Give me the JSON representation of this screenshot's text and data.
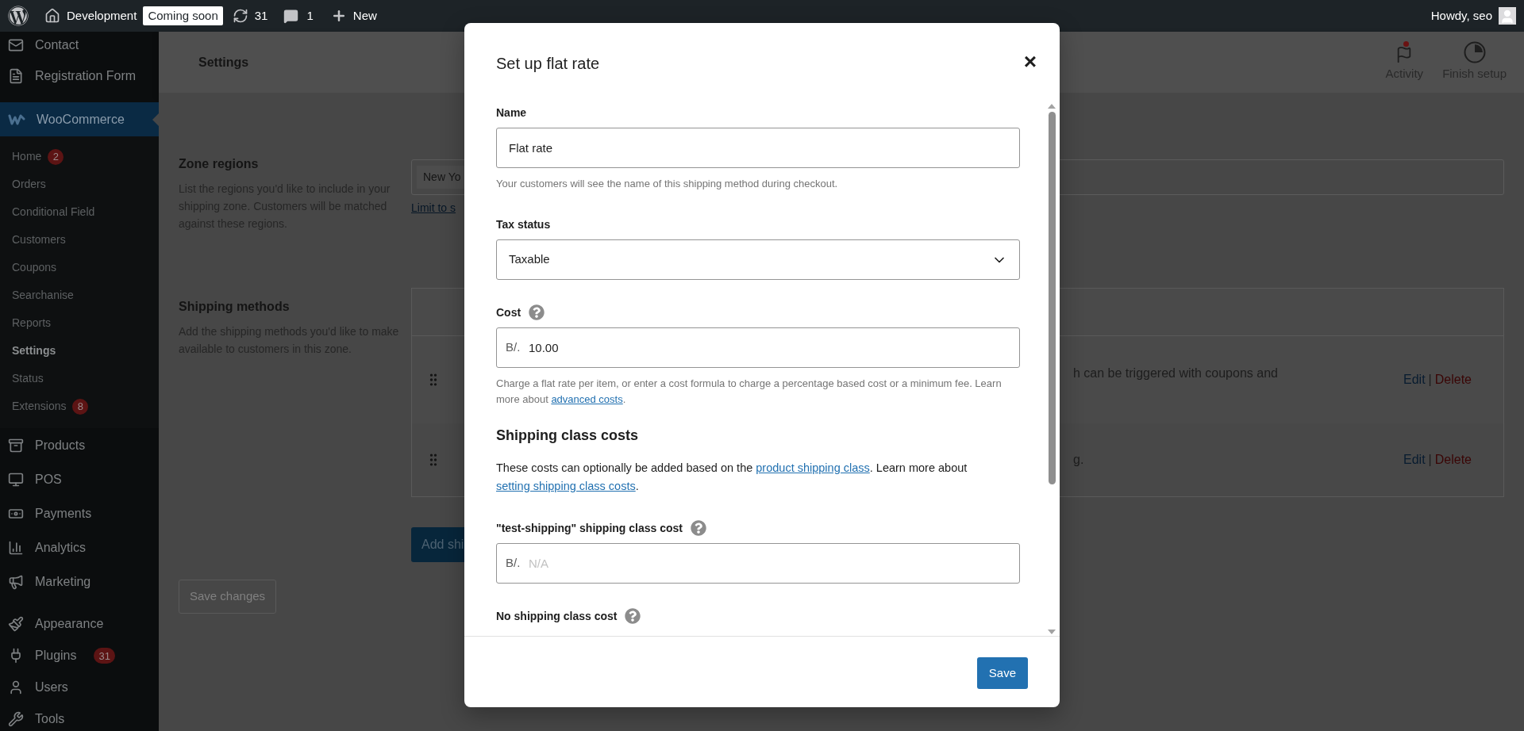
{
  "admin_bar": {
    "site_name": "Development",
    "status_badge": "Coming soon",
    "updates_count": "31",
    "comments_count": "1",
    "new_label": "New",
    "greeting": "Howdy, seo"
  },
  "sidebar": {
    "items": [
      {
        "label": "Contact",
        "selected": false
      },
      {
        "label": "Registration Form",
        "selected": false
      },
      {
        "label": "WooCommerce",
        "selected": true,
        "children": [
          {
            "label": "Home",
            "badge": "2",
            "selected": false
          },
          {
            "label": "Orders",
            "selected": false
          },
          {
            "label": "Conditional Field",
            "selected": false
          },
          {
            "label": "Customers",
            "selected": false
          },
          {
            "label": "Coupons",
            "selected": false
          },
          {
            "label": "Searchanise",
            "selected": false
          },
          {
            "label": "Reports",
            "selected": false
          },
          {
            "label": "Settings",
            "selected": true
          },
          {
            "label": "Status",
            "selected": false
          },
          {
            "label": "Extensions",
            "badge": "8",
            "selected": false
          }
        ]
      },
      {
        "label": "Products",
        "selected": false
      },
      {
        "label": "POS",
        "selected": false
      },
      {
        "label": "Payments",
        "selected": false
      },
      {
        "label": "Analytics",
        "selected": false
      },
      {
        "label": "Marketing",
        "selected": false
      },
      {
        "label": "Appearance",
        "selected": false
      },
      {
        "label": "Plugins",
        "badge": "31",
        "selected": false
      },
      {
        "label": "Users",
        "selected": false
      },
      {
        "label": "Tools",
        "selected": false
      }
    ]
  },
  "header": {
    "title": "Settings",
    "actions": [
      {
        "label": "Activity",
        "notification": true
      },
      {
        "label": "Finish setup",
        "notification": false
      }
    ]
  },
  "zone_regions": {
    "title": "Zone regions",
    "description": "List the regions you'd like to include in your shipping zone. Customers will be matched against these regions.",
    "region_chip": "New Yo",
    "link": "Limit to s"
  },
  "shipping_methods": {
    "title": "Shipping methods",
    "description": "Add the shipping methods you'd like to make available to customers in this zone.",
    "rows": [
      {
        "description": "h can be triggered with coupons and",
        "edit": "Edit",
        "separator": "|",
        "delete": "Delete"
      },
      {
        "description": "g.",
        "edit": "Edit",
        "separator": "|",
        "delete": "Delete"
      }
    ],
    "add_button": "Add shi"
  },
  "save_button": {
    "label": "Save changes",
    "disabled": true
  },
  "modal": {
    "title": "Set up flat rate",
    "close": "×",
    "content": [
      {
        "kind": "input",
        "label": "Name",
        "value": "Flat rate",
        "help": "Your customers will see the name of this shipping method during checkout."
      },
      {
        "kind": "select",
        "label": "Tax status",
        "value": "Taxable"
      },
      {
        "kind": "currency",
        "label": "Cost",
        "tooltip": true,
        "prefix": "B/.",
        "value": "10.00",
        "help": "Charge a flat rate per item, or enter a cost formula to charge a percentage based cost or a minimum fee. Learn more about ",
        "help_link": "advanced costs",
        "help_after": "."
      },
      {
        "kind": "heading",
        "label": "Shipping class costs"
      },
      {
        "kind": "paragraph",
        "parts": [
          {
            "text": "These costs can optionally be added based on the "
          },
          {
            "link": "product shipping class"
          },
          {
            "text": ". Learn more about "
          },
          {
            "link": "setting shipping class costs"
          },
          {
            "text": "."
          }
        ]
      },
      {
        "kind": "currency",
        "label": "\"test-shipping\" shipping class cost",
        "tooltip": true,
        "prefix": "B/.",
        "placeholder": "N/A"
      },
      {
        "kind": "label",
        "label": "No shipping class cost",
        "tooltip": true
      }
    ],
    "save": "Save"
  }
}
